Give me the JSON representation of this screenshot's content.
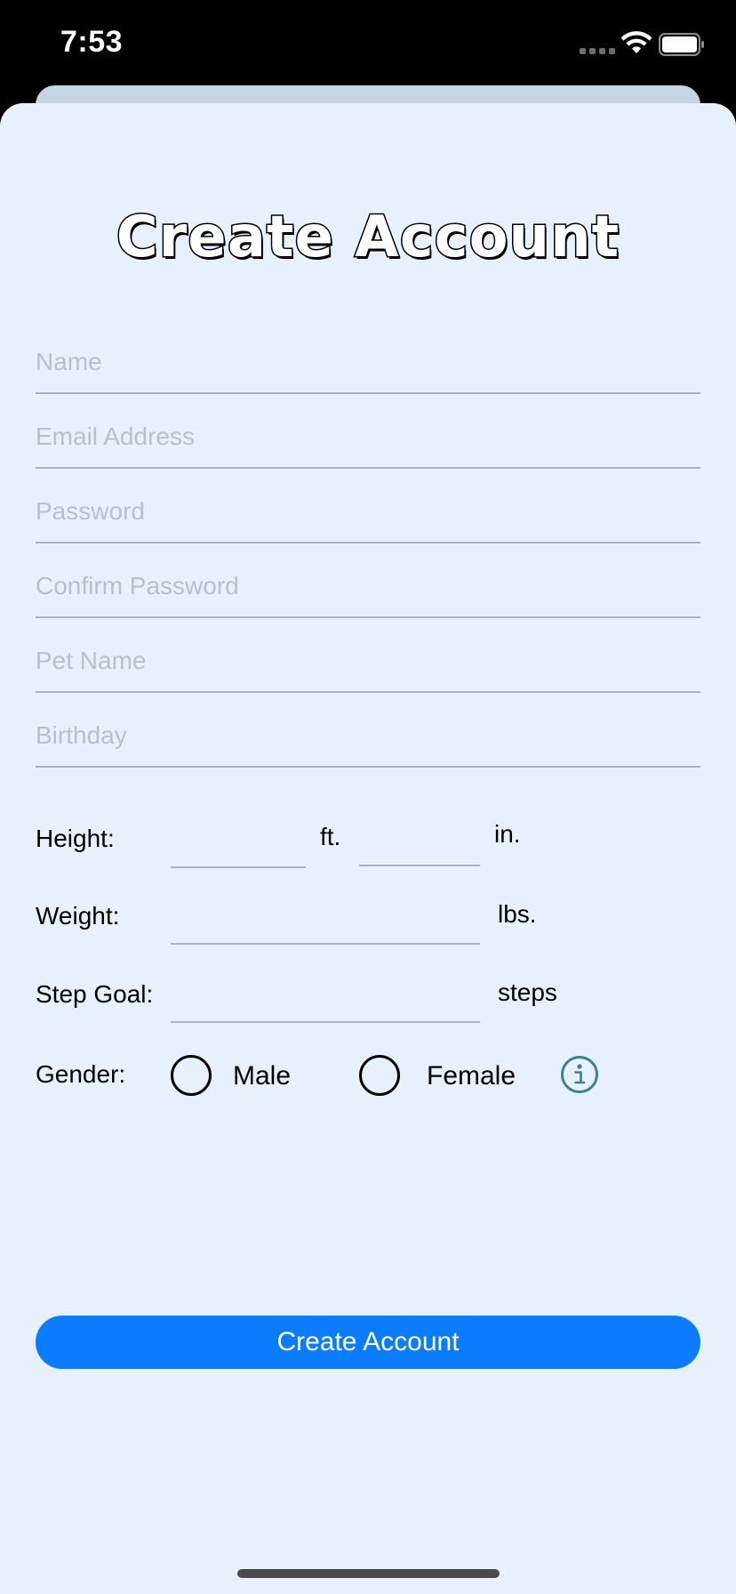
{
  "status_bar": {
    "time": "7:53"
  },
  "title": "Create Account",
  "fields": {
    "name": {
      "placeholder": "Name",
      "value": ""
    },
    "email": {
      "placeholder": "Email Address",
      "value": ""
    },
    "password": {
      "placeholder": "Password",
      "value": ""
    },
    "confirm_password": {
      "placeholder": "Confirm Password",
      "value": ""
    },
    "pet_name": {
      "placeholder": "Pet Name",
      "value": ""
    },
    "birthday": {
      "placeholder": "Birthday",
      "value": ""
    }
  },
  "height": {
    "label": "Height:",
    "feet_unit": "ft.",
    "inches_unit": "in."
  },
  "weight": {
    "label": "Weight:",
    "unit": "lbs."
  },
  "step_goal": {
    "label": "Step Goal:",
    "unit": "steps"
  },
  "gender": {
    "label": "Gender:",
    "options": [
      "Male",
      "Female"
    ],
    "selected": null
  },
  "icons": {
    "info": "info-icon",
    "wifi": "wifi-icon",
    "battery": "battery-icon",
    "signal": "signal-icon"
  },
  "submit_label": "Create Account",
  "colors": {
    "background": "#e6f1fd",
    "accent": "#0a7cfd",
    "info_icon": "#3e7f91",
    "placeholder": "#b8c1cb"
  }
}
